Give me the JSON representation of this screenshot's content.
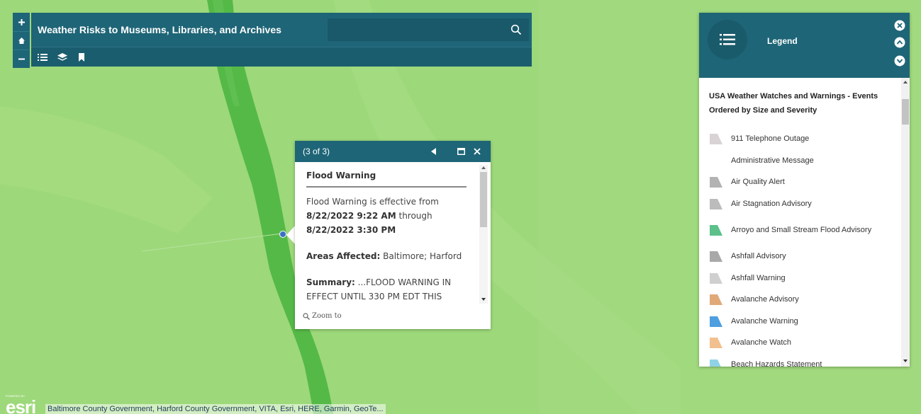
{
  "app": {
    "title": "Weather Risks to Museums, Libraries, and Archives",
    "search_placeholder": ""
  },
  "colors": {
    "brand": "#1e6577",
    "map_land": "#9dd87a",
    "map_river": "#55b947",
    "location_dot": "#3c6fc8"
  },
  "icons": {
    "zoom_in": "plus-icon",
    "home": "home-icon",
    "zoom_out": "minus-icon",
    "search": "search-icon",
    "legend_tool": "list-icon",
    "layers_tool": "layers-icon",
    "bookmarks_tool": "bookmark-icon",
    "popup_prev": "triangle-left-icon",
    "popup_maximize": "maximize-icon",
    "popup_close": "close-icon",
    "zoom_to": "magnifier-icon",
    "legend_panel": "list-icon",
    "legend_close": "close-icon",
    "legend_collapse": "chevron-up-icon",
    "legend_expand": "chevron-down-icon"
  },
  "popup": {
    "count": "(3 of 3)",
    "title": "Flood Warning",
    "lead": "Flood Warning is effective from",
    "from": "8/22/2022 9:22 AM",
    "through_word": "through",
    "to": "8/22/2022 3:30 PM",
    "areas_label": "Areas Affected:",
    "areas_value": "Baltimore; Harford",
    "summary_label": "Summary:",
    "summary_value": "...FLOOD WARNING IN EFFECT UNTIL 330 PM EDT THIS",
    "zoom_to": "Zoom to"
  },
  "legend": {
    "title": "Legend",
    "layer_title": "USA Weather Watches and Warnings - Events Ordered by Size and Severity",
    "items": [
      {
        "label": "911 Telephone Outage",
        "color": "#d9d3d6"
      },
      {
        "label": "Administrative Message",
        "color": "#ffffff"
      },
      {
        "label": "Air Quality Alert",
        "color": "#b3b3b3"
      },
      {
        "label": "Air Stagnation Advisory",
        "color": "#bcbcbc"
      },
      {
        "label": "Arroyo and Small Stream Flood Advisory",
        "color": "#5cc08a"
      },
      {
        "label": "Ashfall Advisory",
        "color": "#a9a9a9"
      },
      {
        "label": "Ashfall Warning",
        "color": "#cfcfcf"
      },
      {
        "label": "Avalanche Advisory",
        "color": "#e0a978"
      },
      {
        "label": "Avalanche Warning",
        "color": "#4f9fe0"
      },
      {
        "label": "Avalanche Watch",
        "color": "#f2c08e"
      },
      {
        "label": "Beach Hazards Statement",
        "color": "#8fd3e6"
      }
    ]
  },
  "attribution": {
    "powered_by": "POWERED BY",
    "credits": "Baltimore County Government, Harford County Government, VITA, Esri, HERE, Garmin, GeoTe..."
  }
}
